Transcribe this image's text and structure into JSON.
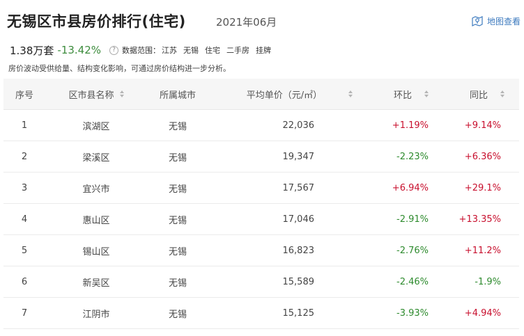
{
  "header": {
    "title": "无锡区市县房价排行(住宅)",
    "date": "2021年06月",
    "map_link": "地图查看"
  },
  "summary": {
    "count": "1.38万套",
    "change": "-13.42%",
    "help_glyph": "?",
    "scope_label": "数据范围：",
    "scope_items": [
      "江苏",
      "无锡",
      "住宅",
      "二手房",
      "挂牌"
    ]
  },
  "note": "房价波动受供给量、结构变化影响，可通过房价结构进一步分析。",
  "table": {
    "columns": [
      "序号",
      "区市县名称",
      "所属城市",
      "平均单价（元/㎡）",
      "环比",
      "同比"
    ],
    "rows": [
      {
        "no": "1",
        "name": "滨湖区",
        "city": "无锡",
        "price": "22,036",
        "mom": "+1.19%",
        "yoy": "+9.14%"
      },
      {
        "no": "2",
        "name": "梁溪区",
        "city": "无锡",
        "price": "19,347",
        "mom": "-2.23%",
        "yoy": "+6.36%"
      },
      {
        "no": "3",
        "name": "宜兴市",
        "city": "无锡",
        "price": "17,567",
        "mom": "+6.94%",
        "yoy": "+29.1%"
      },
      {
        "no": "4",
        "name": "惠山区",
        "city": "无锡",
        "price": "17,046",
        "mom": "-2.91%",
        "yoy": "+13.35%"
      },
      {
        "no": "5",
        "name": "锡山区",
        "city": "无锡",
        "price": "16,823",
        "mom": "-2.76%",
        "yoy": "+11.2%"
      },
      {
        "no": "6",
        "name": "新吴区",
        "city": "无锡",
        "price": "15,589",
        "mom": "-2.46%",
        "yoy": "-1.9%"
      },
      {
        "no": "7",
        "name": "江阴市",
        "city": "无锡",
        "price": "15,125",
        "mom": "-3.93%",
        "yoy": "+4.94%"
      }
    ]
  },
  "colors": {
    "positive": "#c8102e",
    "negative": "#2e8b2e",
    "link": "#3e7bbf"
  },
  "icons": {
    "map_link": "map-location-icon",
    "help": "question-circle-icon",
    "sort": "sort-arrows-icon"
  }
}
